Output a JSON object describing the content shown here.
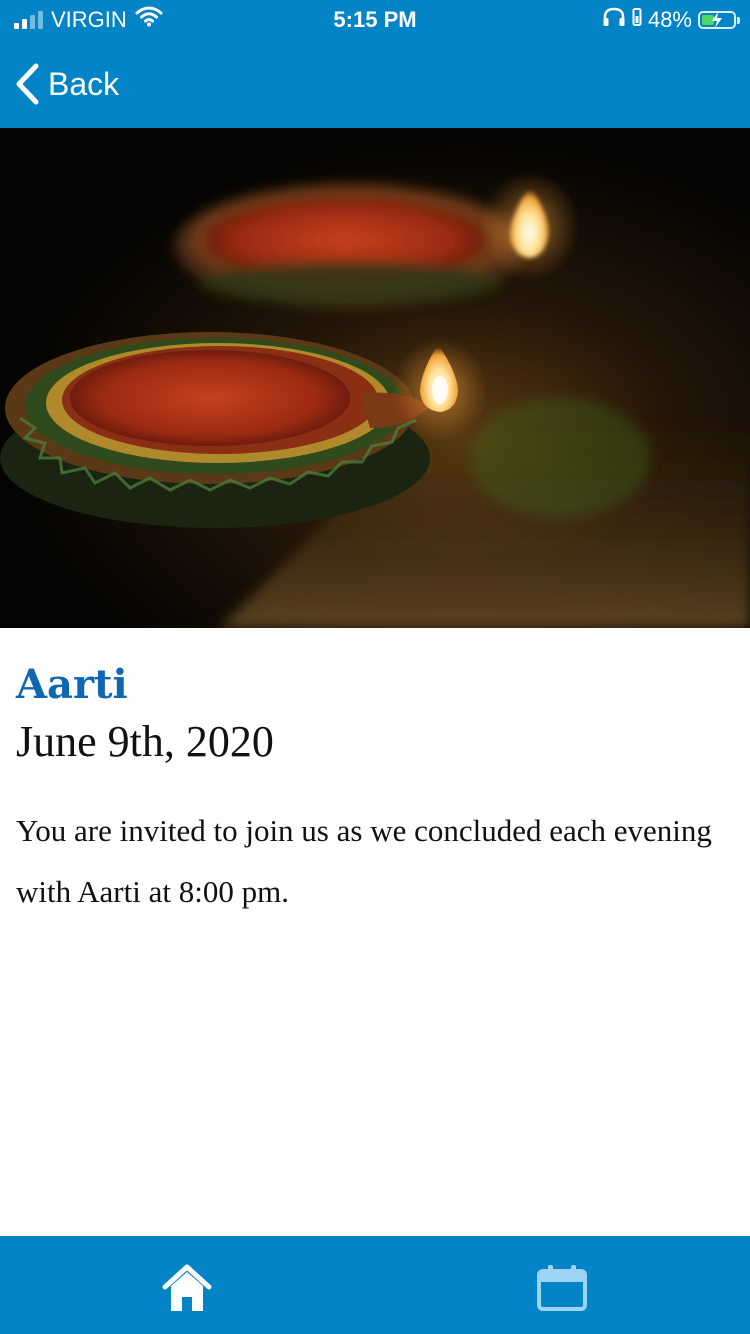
{
  "status_bar": {
    "carrier": "VIRGIN",
    "time": "5:15 PM",
    "battery_percent": "48%",
    "battery_level": 0.48,
    "signal_bars_active": 2,
    "signal_bars_total": 4,
    "icons": [
      "signal-icon",
      "wifi-icon",
      "headphones-icon",
      "battery-icon"
    ]
  },
  "nav": {
    "back_label": "Back",
    "back_icon": "chevron-left-icon"
  },
  "hero": {
    "subject": "diya-lamps-image"
  },
  "event": {
    "title": "Aarti",
    "date": "June 9th, 2020",
    "description": "You are invited to join us as we concluded each evening with Aarti at 8:00 pm."
  },
  "tabbar": {
    "items": [
      {
        "name": "home",
        "icon": "home-icon",
        "active": true
      },
      {
        "name": "calendar",
        "icon": "calendar-icon",
        "active": false
      }
    ]
  },
  "colors": {
    "header": "#0284c7",
    "title": "#0f66b1",
    "body_text": "#111111",
    "battery_fill": "#4cd964"
  }
}
